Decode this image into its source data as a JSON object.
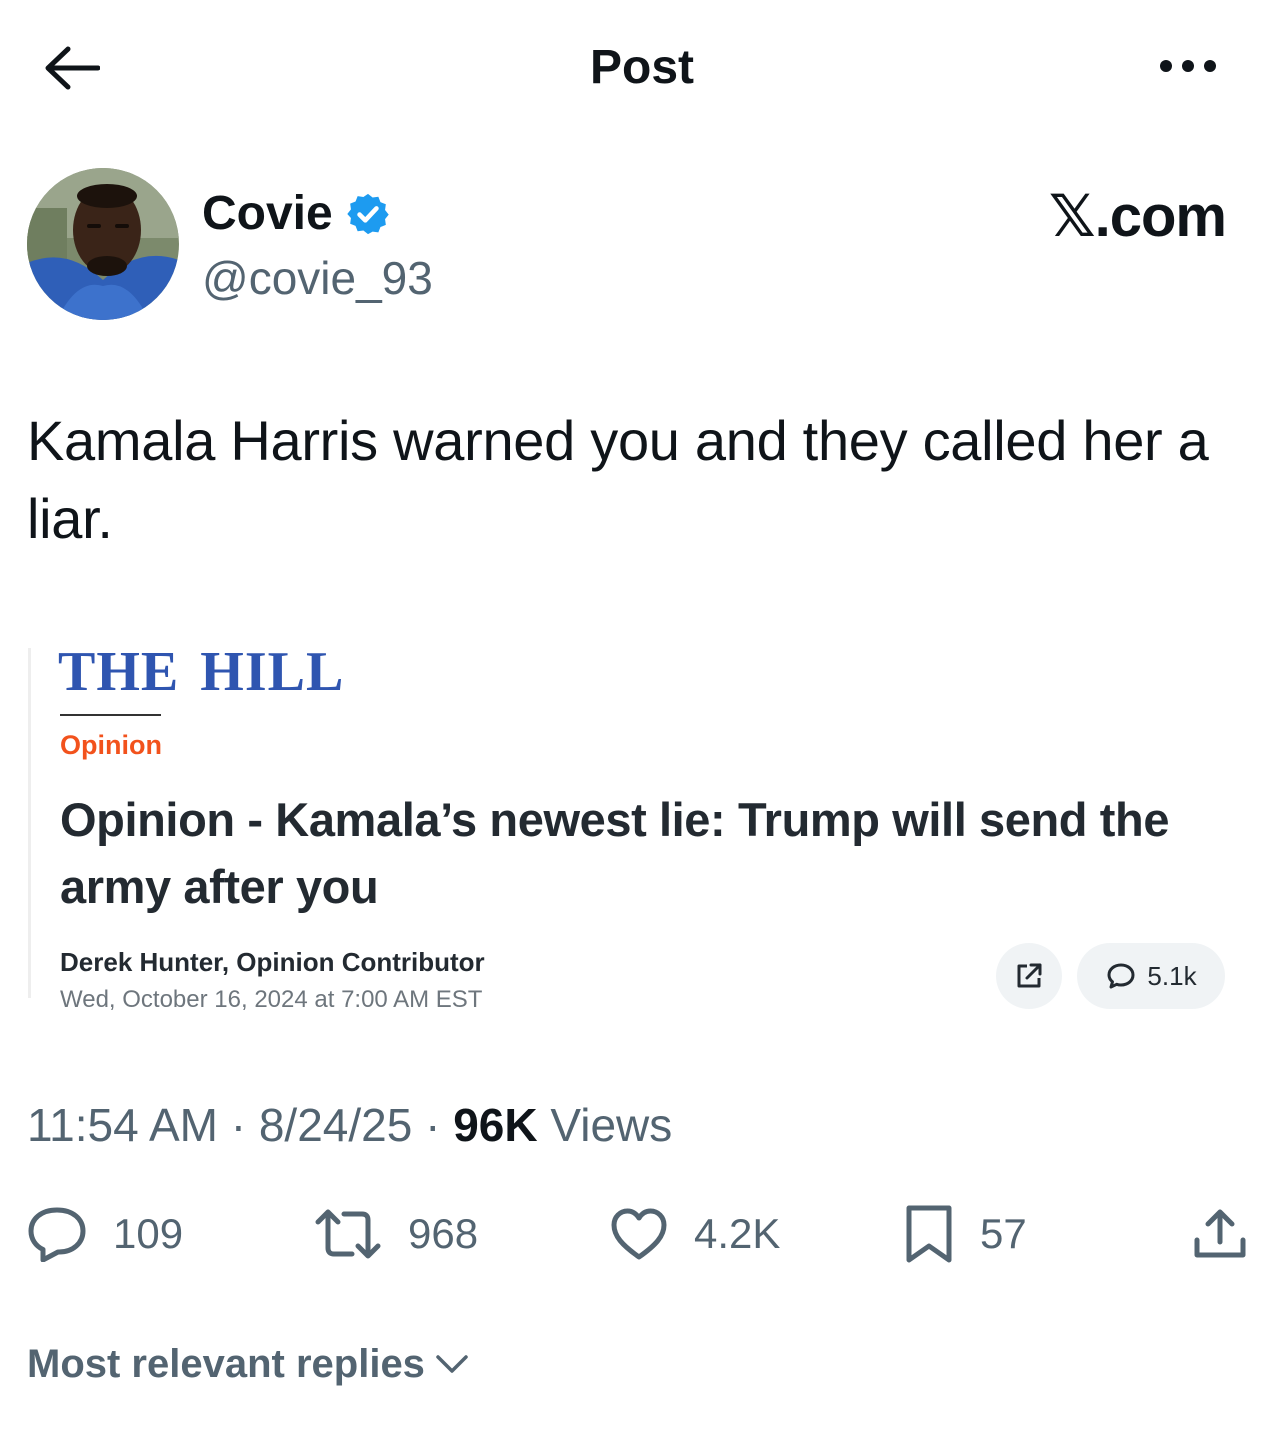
{
  "header": {
    "title": "Post"
  },
  "author": {
    "display_name": "Covie",
    "handle": "@covie_93",
    "verified": true
  },
  "site_mark": "𝕏.com",
  "tweet": {
    "text": "Kamala Harris warned you and they called her a liar."
  },
  "article": {
    "publication": "THE HILL",
    "section": "Opinion",
    "headline": "Opinion - Kamala’s newest lie: Trump will send the army after you",
    "byline": "Derek Hunter, Opinion Contributor",
    "date": "Wed, October 16, 2024 at 7:00 AM EST",
    "comment_count": "5.1k"
  },
  "meta": {
    "time": "11:54 AM",
    "date": "8/24/25",
    "views_count": "96K",
    "views_label": "Views"
  },
  "actions": {
    "replies": "109",
    "reposts": "968",
    "likes": "4.2K",
    "bookmarks": "57"
  },
  "replies_sort": {
    "label": "Most relevant replies"
  },
  "colors": {
    "text": "#0f1419",
    "muted": "#536471",
    "verified": "#1d9bf0",
    "hill_blue": "#2f55b0",
    "opinion_orange": "#f2521c"
  }
}
